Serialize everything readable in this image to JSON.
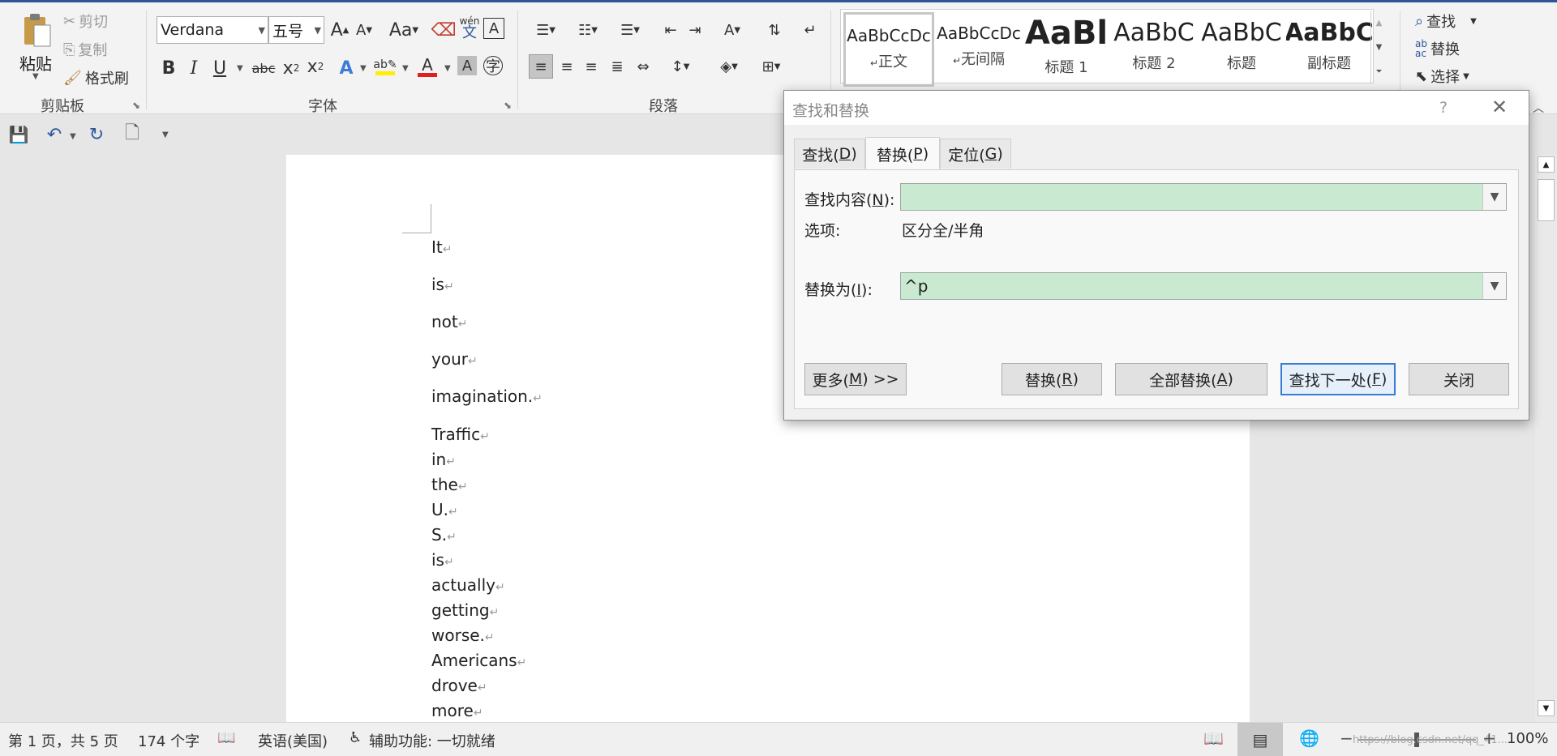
{
  "ribbon": {
    "clipboard": {
      "paste": "粘贴",
      "cut": "剪切",
      "copy": "复制",
      "format_painter": "格式刷",
      "group_label": "剪贴板"
    },
    "font": {
      "name": "Verdana",
      "size": "五号",
      "group_label": "字体",
      "grow": "A",
      "shrink": "A",
      "case": "Aa",
      "phonetic": "wén"
    },
    "paragraph": {
      "group_label": "段落"
    },
    "styles": [
      {
        "preview": "AaBbCcDc",
        "name": "正文",
        "pm": "↵"
      },
      {
        "preview": "AaBbCcDc",
        "name": "无间隔",
        "pm": "↵"
      },
      {
        "preview": "AaBl",
        "name": "标题 1"
      },
      {
        "preview": "AaBbC",
        "name": "标题 2"
      },
      {
        "preview": "AaBbC",
        "name": "标题"
      },
      {
        "preview": "AaBbC",
        "name": "副标题"
      }
    ],
    "editing": {
      "find": "查找",
      "replace": "替换",
      "select": "选择"
    }
  },
  "document": {
    "paragraphs": [
      "It",
      "is",
      "not",
      "your",
      "imagination."
    ],
    "lines": [
      "Traffic",
      "in",
      "the",
      "U.",
      "S.",
      "is",
      "actually",
      "getting",
      "worse.",
      "Americans",
      "drove",
      "more"
    ],
    "para_mark": "↵"
  },
  "dialog": {
    "title": "查找和替换",
    "help": "?",
    "tabs": [
      {
        "label": "查找(",
        "key": "D",
        "end": ")"
      },
      {
        "label": "替换(",
        "key": "P",
        "end": ")"
      },
      {
        "label": "定位(",
        "key": "G",
        "end": ")"
      }
    ],
    "find_label": "查找内容(",
    "find_key": "N",
    "find_end": "):",
    "find_value": "",
    "options_label": "选项:",
    "options_value": "区分全/半角",
    "replace_label": "替换为(",
    "replace_key": "I",
    "replace_end": "):",
    "replace_value": "^p",
    "buttons": {
      "more": {
        "label": "更多(",
        "key": "M",
        "end": ") >>"
      },
      "replace": {
        "label": "替换(",
        "key": "R",
        "end": ")"
      },
      "replace_all": {
        "label": "全部替换(",
        "key": "A",
        "end": ")"
      },
      "find_next": {
        "label": "查找下一处(",
        "key": "F",
        "end": ")"
      },
      "close": "关闭"
    }
  },
  "status": {
    "page": "第 1 页，共 5 页",
    "words": "174 个字",
    "language": "英语(美国)",
    "accessibility": "辅助功能: 一切就绪",
    "zoom": "100%",
    "watermark": "https://blog.csdn.net/qq_41..."
  },
  "colors": {
    "accent": "#2b579a",
    "field_bg": "#c9ead0",
    "focus_border": "#3a7bd5"
  }
}
